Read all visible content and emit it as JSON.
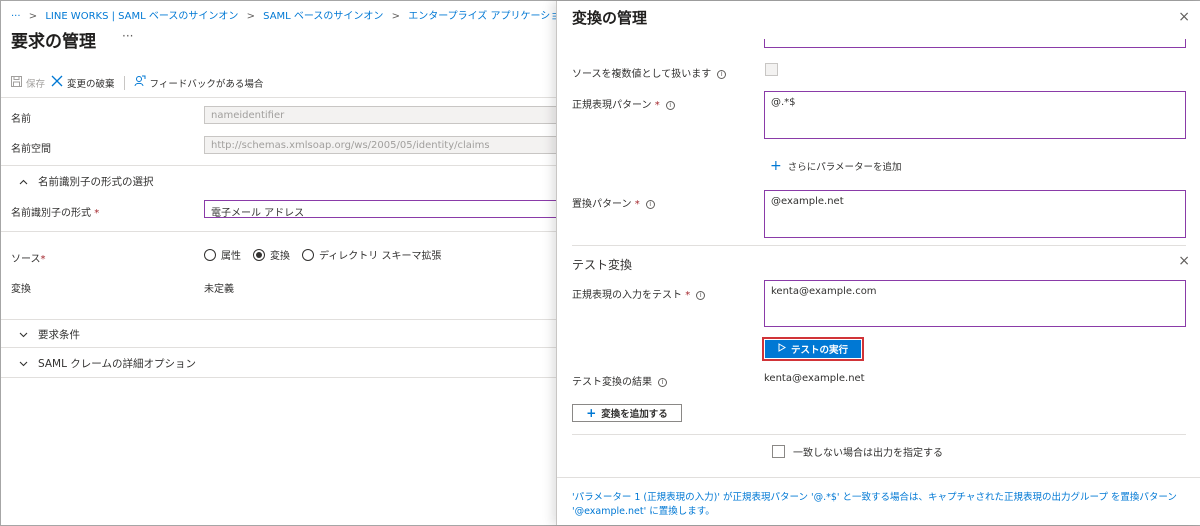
{
  "breadcrumb": {
    "ellipsis": "···",
    "items": [
      "LINE WORKS | SAML ベースのサインオン",
      "SAML ベースのサインオン",
      "エンタープライズ アプリケーション | すべての"
    ],
    "separator": ">"
  },
  "page": {
    "title": "要求の管理",
    "more": "···"
  },
  "toolbar": {
    "save_label": "保存",
    "discard_label": "変更の破棄",
    "feedback_label": "フィードバックがある場合"
  },
  "form": {
    "name_label": "名前",
    "name_value": "nameidentifier",
    "namespace_label": "名前空間",
    "namespace_value": "http://schemas.xmlsoap.org/ws/2005/05/identity/claims",
    "format_section_label": "名前識別子の形式の選択",
    "format_label": "名前識別子の形式",
    "format_value": "電子メール アドレス",
    "source_label": "ソース",
    "source_options": [
      "属性",
      "変換",
      "ディレクトリ スキーマ拡張"
    ],
    "source_selected": "変換",
    "transform_label": "変換",
    "transform_value": "未定義",
    "required_mark": "*",
    "claim_conditions_label": "要求条件",
    "advanced_label": "SAML クレームの詳細オプション"
  },
  "panel": {
    "title": "変換の管理",
    "close": "×",
    "multivalue_label": "ソースを複数値として扱います",
    "regex_pattern_label": "正規表現パターン",
    "regex_pattern_value": "@.*$",
    "add_parameter_label": "さらにパラメーターを追加",
    "replace_pattern_label": "置換パターン",
    "replace_pattern_value": "@example.net",
    "test_section_title": "テスト変換",
    "test_input_label": "正規表現の入力をテスト",
    "test_input_value": "kenta@example.com",
    "run_test_label": "テストの実行",
    "test_result_label": "テスト変換の結果",
    "test_result_value": "kenta@example.net",
    "add_transform_label": "変換を追加する",
    "no_match_label": "一致しない場合は出力を指定する",
    "note_line1": "'パラメーター 1 (正規表現の入力)' が正規表現パターン '@.*$' と一致する場合は、キャプチャされた正規表現の出力グループ を置換パターン",
    "note_line2": "'@example.net' に置換します。",
    "required_mark": "*",
    "info": "i"
  },
  "colors": {
    "accent": "#0078d4",
    "focus_border": "#8a3ba8",
    "highlight": "#d13438"
  }
}
